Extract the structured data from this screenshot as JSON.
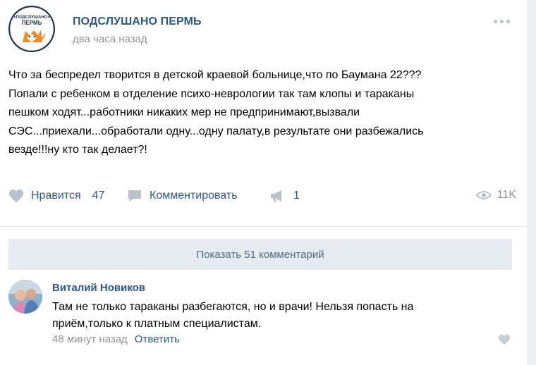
{
  "post": {
    "group_name": "ПОДСЛУШАНО ПЕРМЬ",
    "time": "два часа назад",
    "avatar_text_top": "«ПОДСЛУШАНО»",
    "avatar_text_bottom": "ПЕРМЬ",
    "text_lines": [
      "Что за беспредел творится в детской краевой больнице,что по Баумана 22???",
      "Попали с ребенком в отделение психо-неврологии так там клопы и тараканы",
      "пешком ходят...работники никаких мер не предпринимают,вызвали",
      "СЭС...приехали...обработали одну...одну палату,в результате они разбежались",
      "везде!!!ну кто так делает?!"
    ],
    "actions": {
      "like_label": "Нравится",
      "like_count": "47",
      "comment_label": "Комментировать",
      "share_count": "1",
      "views_count": "11K"
    }
  },
  "comments": {
    "show_more_label": "Показать 51 комментарий",
    "items": [
      {
        "author": "Виталий Новиков",
        "text_lines": [
          "Там не только тараканы разбегаются, но и врачи! Нельзя попасть на",
          "приём,только к платным специалистам."
        ],
        "time": "48 минут назад",
        "reply_label": "Ответить"
      }
    ]
  },
  "colors": {
    "link": "#2a5885",
    "secondary": "#939393",
    "icon": "#b8c2cc",
    "button_bg": "#e5ebf1"
  }
}
